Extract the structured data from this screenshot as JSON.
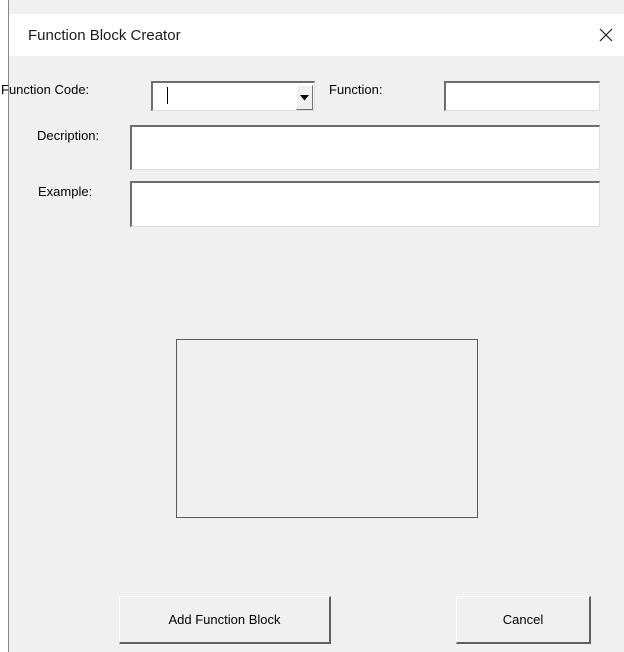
{
  "window": {
    "title": "Function Block Creator",
    "close_symbol": "✕"
  },
  "form": {
    "function_code_label": "Function Code:",
    "function_code_value": "",
    "function_label": "Function:",
    "function_value": "",
    "description_label": "Decription:",
    "description_value": "",
    "example_label": "Example:",
    "example_value": ""
  },
  "buttons": {
    "add_label": "Add Function Block",
    "cancel_label": "Cancel"
  },
  "icons": {
    "close": "close-icon",
    "dropdown": "chevron-down-icon"
  },
  "colors": {
    "dialog_background": "#f0f0f0",
    "titlebar_background": "#ffffff",
    "field_background": "#ffffff"
  }
}
